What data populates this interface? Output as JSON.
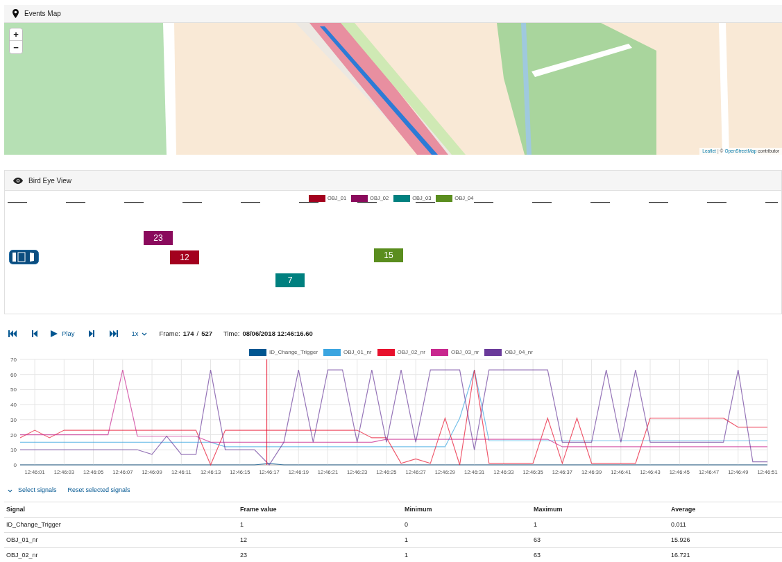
{
  "events_map": {
    "title": "Events Map",
    "zoom_in": "+",
    "zoom_out": "−",
    "attribution": {
      "leaflet": "Leaflet",
      "separator": "|",
      "copyright": "©",
      "osm": "OpenStreetMap",
      "suffix": "contributor"
    }
  },
  "bird_eye": {
    "title": "Bird Eye View",
    "legend": [
      {
        "label": "OBJ_01",
        "color": "#a3001e"
      },
      {
        "label": "OBJ_02",
        "color": "#8a0a5c"
      },
      {
        "label": "OBJ_03",
        "color": "#00807f"
      },
      {
        "label": "OBJ_04",
        "color": "#5a8d1e"
      }
    ],
    "objects": [
      {
        "label": "23",
        "color": "#8a0a5c"
      },
      {
        "label": "12",
        "color": "#a3001e"
      },
      {
        "label": "15",
        "color": "#5a8d1e"
      },
      {
        "label": "7",
        "color": "#00807f"
      }
    ]
  },
  "player": {
    "play": "Play",
    "speed": "1x",
    "frame_label": "Frame:",
    "frame": "174",
    "frame_sep": "/",
    "frame_total": "527",
    "time_label": "Time:",
    "time": "08/06/2018 12:46:16.60"
  },
  "chart": {
    "chart_data": {
      "type": "line",
      "categories": [
        null,
        "12:46:01",
        null,
        "12:46:03",
        null,
        "12:46:05",
        null,
        "12:46:07",
        null,
        "12:46:09",
        null,
        "12:46:11",
        null,
        "12:46:13",
        null,
        "12:46:15",
        null,
        "12:46:17",
        null,
        "12:46:19",
        null,
        "12:46:21",
        null,
        "12:46:23",
        null,
        "12:46:25",
        null,
        "12:46:27",
        null,
        "12:46:29",
        null,
        "12:46:31",
        null,
        "12:46:33",
        null,
        "12:46:35",
        null,
        "12:46:37",
        null,
        "12:46:39",
        null,
        "12:46:41",
        null,
        "12:46:43",
        null,
        "12:46:45",
        null,
        "12:46:47",
        null,
        "12:46:49",
        null,
        "12:46:51"
      ],
      "ylim": [
        0,
        70
      ],
      "yticks": [
        0,
        10,
        20,
        30,
        40,
        50,
        60,
        70
      ],
      "series": [
        {
          "name": "ID_Change_Trigger",
          "color": "#005691",
          "values": [
            0,
            0,
            0,
            0,
            0,
            0,
            0,
            0,
            0,
            0,
            0,
            0,
            0,
            0,
            0,
            0,
            0,
            1,
            0,
            0,
            0,
            0,
            0,
            0,
            0,
            0,
            0,
            0,
            0,
            0,
            0,
            0,
            0,
            0,
            0,
            0,
            0,
            0,
            0,
            0,
            0,
            0,
            0,
            0,
            0,
            0,
            0,
            0,
            0,
            0,
            0,
            0
          ]
        },
        {
          "name": "OBJ_01_nr",
          "color": "#3ba5e0",
          "values": [
            15,
            15,
            15,
            15,
            15,
            15,
            15,
            15,
            15,
            15,
            15,
            15,
            15,
            15,
            12,
            12,
            12,
            12,
            12,
            12,
            12,
            12,
            12,
            12,
            12,
            12,
            12,
            12,
            12,
            12,
            31,
            63,
            16,
            16,
            16,
            16,
            16,
            16,
            16,
            16,
            16,
            16,
            16,
            16,
            16,
            16,
            16,
            16,
            16,
            16,
            16,
            16
          ]
        },
        {
          "name": "OBJ_02_nr",
          "color": "#e8112d",
          "values": [
            18,
            23,
            18,
            23,
            23,
            23,
            23,
            23,
            23,
            23,
            23,
            23,
            23,
            0,
            23,
            23,
            23,
            23,
            23,
            23,
            23,
            23,
            23,
            23,
            18,
            18,
            1,
            4,
            1,
            31,
            0,
            63,
            1,
            1,
            1,
            1,
            31,
            1,
            31,
            1,
            1,
            1,
            1,
            31,
            31,
            31,
            31,
            31,
            31,
            25,
            25,
            25
          ]
        },
        {
          "name": "OBJ_03_nr",
          "color": "#c8278e",
          "values": [
            20,
            20,
            20,
            20,
            20,
            20,
            20,
            63,
            19,
            19,
            19,
            19,
            19,
            15,
            15,
            15,
            15,
            15,
            15,
            15,
            15,
            15,
            15,
            15,
            15,
            17,
            17,
            17,
            17,
            17,
            17,
            17,
            17,
            17,
            17,
            17,
            17,
            12,
            12,
            12,
            12,
            12,
            12,
            12,
            12,
            12,
            12,
            12,
            12,
            12,
            12,
            12
          ]
        },
        {
          "name": "OBJ_04_nr",
          "color": "#6a3a9a",
          "values": [
            10,
            10,
            10,
            10,
            10,
            10,
            10,
            10,
            10,
            7,
            19,
            7,
            7,
            63,
            10,
            10,
            10,
            0,
            15,
            63,
            15,
            63,
            63,
            15,
            63,
            15,
            63,
            15,
            63,
            63,
            63,
            10,
            63,
            63,
            63,
            63,
            63,
            15,
            15,
            15,
            63,
            15,
            63,
            15,
            15,
            15,
            15,
            15,
            15,
            63,
            2,
            2
          ]
        }
      ],
      "grid": true
    }
  },
  "signal_actions": {
    "select": "Select signals",
    "reset": "Reset selected signals"
  },
  "table": {
    "columns": [
      "Signal",
      "Frame value",
      "Minimum",
      "Maximum",
      "Average"
    ],
    "rows": [
      [
        "ID_Change_Trigger",
        "1",
        "0",
        "1",
        "0.011"
      ],
      [
        "OBJ_01_nr",
        "12",
        "1",
        "63",
        "15.926"
      ],
      [
        "OBJ_02_nr",
        "23",
        "1",
        "63",
        "16.721"
      ]
    ]
  }
}
